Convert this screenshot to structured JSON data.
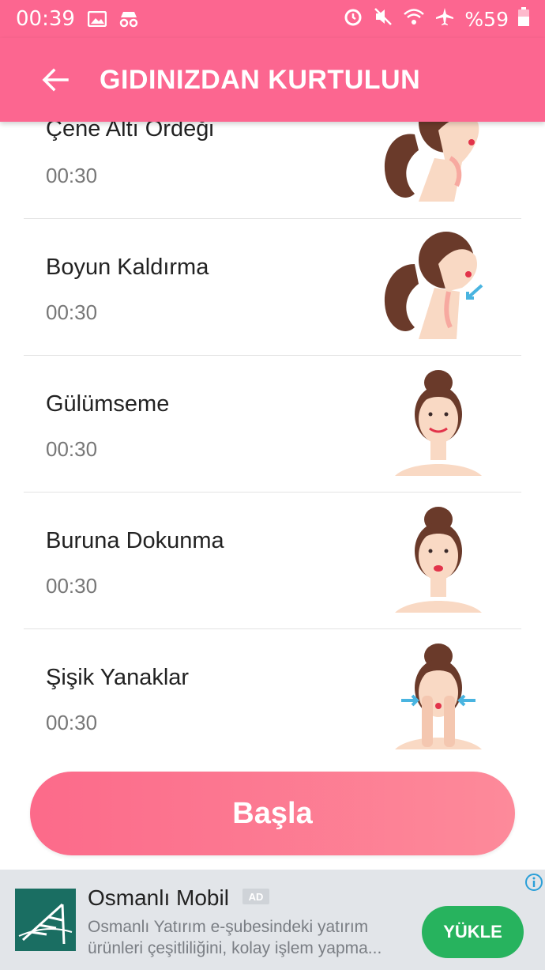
{
  "status_bar": {
    "time": "00:39",
    "battery": "%59"
  },
  "app_bar": {
    "title": "GIDINIZDAN KURTULUN"
  },
  "exercises": [
    {
      "name": "Çene Altı Ordeği",
      "duration": "00:30"
    },
    {
      "name": "Boyun Kaldırma",
      "duration": "00:30"
    },
    {
      "name": "Gülümseme",
      "duration": "00:30"
    },
    {
      "name": "Buruna Dokunma",
      "duration": "00:30"
    },
    {
      "name": "Şişik Yanaklar",
      "duration": "00:30"
    }
  ],
  "start_button": {
    "label": "Başla"
  },
  "ad": {
    "title": "Osmanlı Mobil",
    "badge": "AD",
    "description": "Osmanlı Yatırım e-şubesindeki yatırım ürünleri çeşitliliğini, kolay işlem yapma...",
    "cta": "YÜKLE"
  },
  "colors": {
    "primary": "#fc6690",
    "cta_green": "#27b35e",
    "ad_bg": "#e2e5e9"
  }
}
